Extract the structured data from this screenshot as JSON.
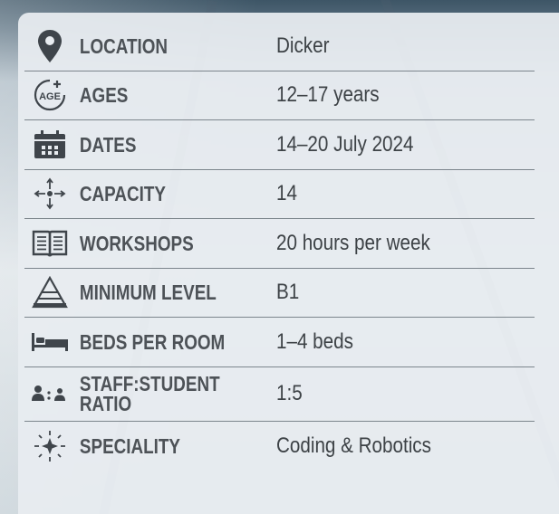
{
  "rows": [
    {
      "label": "LOCATION",
      "value": "Dicker",
      "icon": "location-pin-icon"
    },
    {
      "label": "AGES",
      "value": "12–17 years",
      "icon": "age-icon",
      "icon_text": "AGE"
    },
    {
      "label": "DATES",
      "value": "14–20 July 2024",
      "icon": "calendar-icon"
    },
    {
      "label": "CAPACITY",
      "value": "14",
      "icon": "capacity-arrows-icon"
    },
    {
      "label": "WORKSHOPS",
      "value": "20 hours per week",
      "icon": "open-book-icon"
    },
    {
      "label": "MINIMUM LEVEL",
      "value": "B1",
      "icon": "pyramid-icon"
    },
    {
      "label": "BEDS PER ROOM",
      "value": "1–4 beds",
      "icon": "bed-icon"
    },
    {
      "label": "STAFF:STUDENT RATIO",
      "value": "1:5",
      "icon": "staff-student-icon"
    },
    {
      "label": "SPECIALITY",
      "value": "Coding & Robotics",
      "icon": "star-burst-icon"
    }
  ],
  "colors": {
    "icon": "#3f454b",
    "label": "#4d5257",
    "value": "#3d4246",
    "divider": "#7c858c",
    "panel": "#e8ecf0"
  }
}
